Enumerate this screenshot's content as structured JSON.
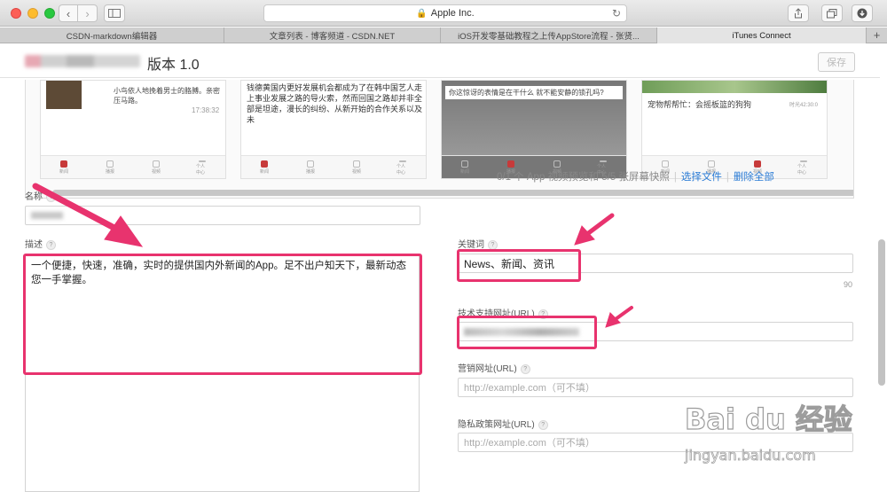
{
  "browser": {
    "address": "Apple Inc.",
    "tabs": [
      {
        "label": "CSDN-markdown编辑器",
        "active": false
      },
      {
        "label": "文章列表 - 博客频道 - CSDN.NET",
        "active": false
      },
      {
        "label": "iOS开发零基础教程之上传AppStore流程 - 张贤...",
        "active": false
      },
      {
        "label": "iTunes Connect",
        "active": true
      }
    ],
    "new_tab": "+"
  },
  "header": {
    "version_label": "版本 1.0",
    "save_label": "保存"
  },
  "screenshots": {
    "shot1_text": "小鸟依人地挽着男士的胳膊。亲密压马路。",
    "shot1_time": "17:38:32",
    "shot2_text": "钱德黄国内更好发展机会都成为了在韩中国艺人走上事业发展之路的导火索，然而回国之路却并非全部是坦途，漫长的纠纷、从新开始的合作关系以及未",
    "shot3_text": "你这惊讶的表情是在干什么 就不能安静的锁孔吗?",
    "shot4_text": "宠物帮帮忙：会摇板篮的狗狗",
    "shot4_time": "时光42:30:0",
    "tabbar_labels": [
      "新闻",
      "播报",
      "视频",
      "个人中心"
    ]
  },
  "counter": {
    "text": "0/1 个 App 视频预览和 5/5 张屏幕快照",
    "choose_file": "选择文件",
    "delete_all": "删除全部"
  },
  "form": {
    "name_label": "名称",
    "description_label": "描述",
    "description_value": "一个便捷，快速，准确，实时的提供国内外新闻的App。足不出户知天下，最新动态您一手掌握。",
    "keywords_label": "关键词",
    "keywords_value": "News、新闻、资讯",
    "keywords_count": "90",
    "support_url_label": "技术支持网址(URL)",
    "marketing_url_label": "营销网址(URL)",
    "marketing_url_placeholder": "http://example.com（可不填）",
    "privacy_url_label": "隐私政策网址(URL)",
    "privacy_url_placeholder": "http://example.com（可不填）",
    "help_glyph": "?"
  },
  "watermark": {
    "logo": "Bai du 经验",
    "url": "jingyan.baidu.com"
  },
  "colors": {
    "highlight": "#e8336e",
    "link": "#2a7bd5"
  }
}
